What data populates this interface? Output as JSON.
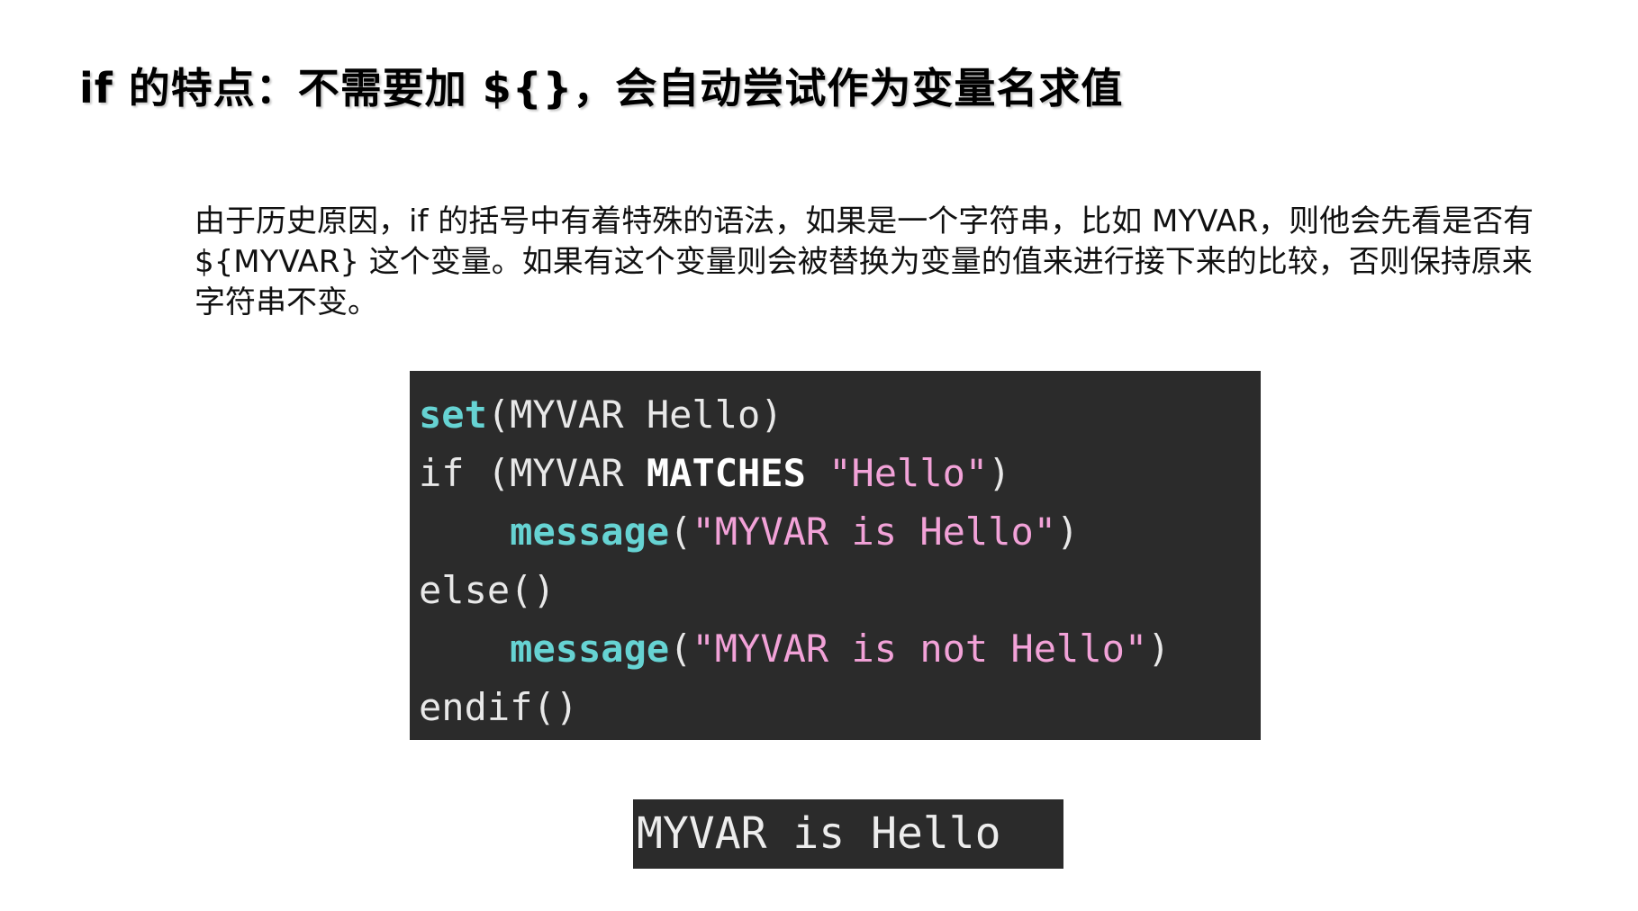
{
  "title": "if 的特点：不需要加 ${}，会自动尝试作为变量名求值",
  "paragraph": "由于历史原因，if 的括号中有着特殊的语法，如果是一个字符串，比如 MYVAR，则他会先看是否有 ${MYVAR} 这个变量。如果有这个变量则会被替换为变量的值来进行接下来的比较，否则保持原来字符串不变。",
  "code": {
    "line1": {
      "kw": "set",
      "rest": "(MYVAR Hello)"
    },
    "line2": {
      "kw": "if",
      "open": " (MYVAR ",
      "op": "MATCHES",
      "str": "\"Hello\"",
      "close": ")"
    },
    "line3": {
      "indent": "    ",
      "kw": "message",
      "open": "(",
      "str": "\"MYVAR is Hello\"",
      "close": ")"
    },
    "line4": {
      "kw": "else",
      "rest": "()"
    },
    "line5": {
      "indent": "    ",
      "kw": "message",
      "open": "(",
      "str": "\"MYVAR is not Hello\"",
      "close": ")"
    },
    "line6": {
      "kw": "endif",
      "rest": "()"
    }
  },
  "output": "MYVAR is Hello",
  "colors": {
    "code_background": "#2b2b2b",
    "function_keyword": "#66d3d3",
    "string_literal": "#f2a2d8",
    "plain_code": "#e8e8e8"
  }
}
